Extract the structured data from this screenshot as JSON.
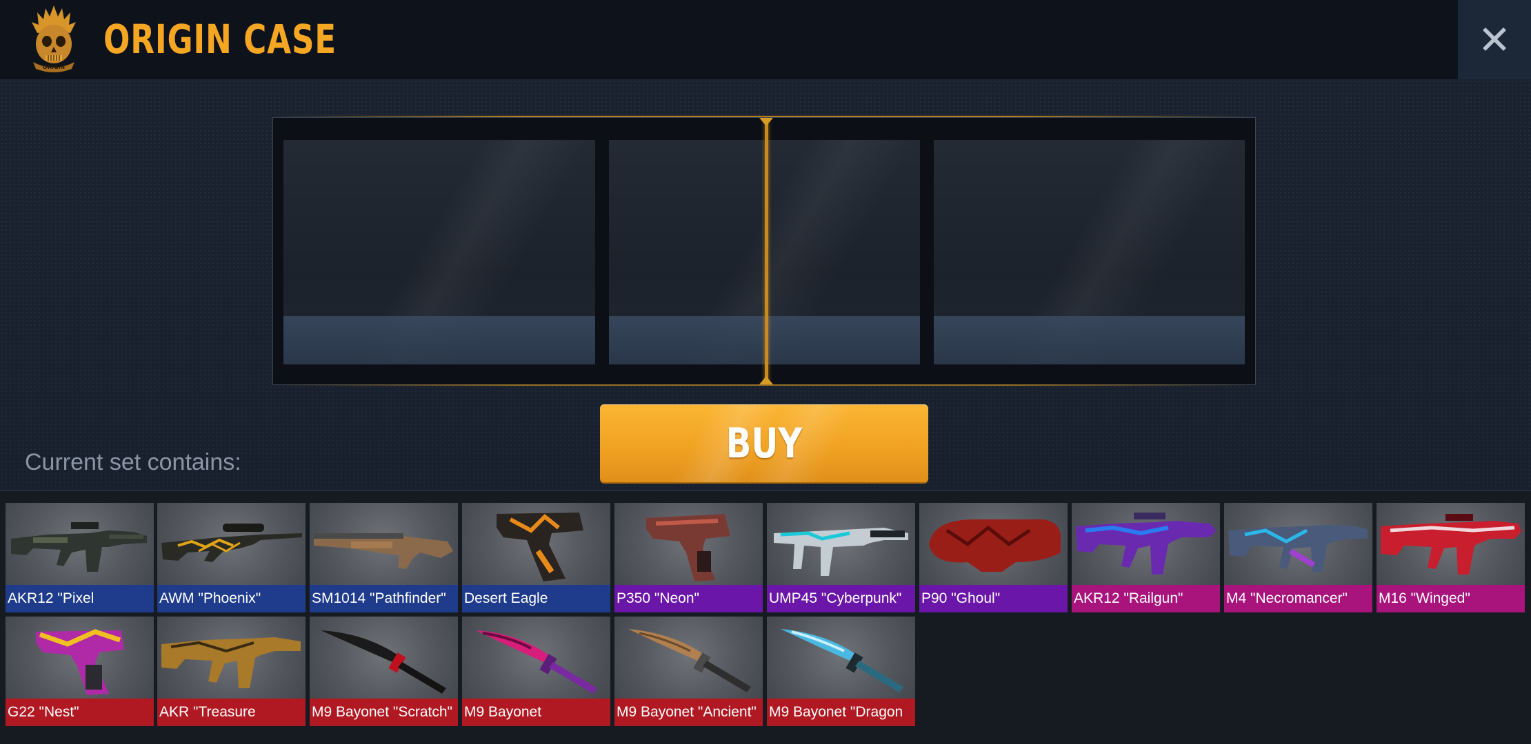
{
  "header": {
    "title": "ORIGIN CASE",
    "logo_text": "ORIGIN",
    "close_glyph": "✕"
  },
  "buy_button": {
    "label": "BUY"
  },
  "set_label": "Current set contains:",
  "colors": {
    "accent": "#f5a623",
    "rarity_blue": "#1f3c8c",
    "rarity_purple": "#6a16a8",
    "rarity_pink": "#a8137c",
    "rarity_red": "#b01822"
  },
  "items": [
    {
      "name": "AKR12 \"Pixel",
      "rarity": "blue",
      "icon": "rifle-icon"
    },
    {
      "name": "AWM \"Phoenix\"",
      "rarity": "blue",
      "icon": "sniper-rifle-icon"
    },
    {
      "name": "SM1014 \"Pathfinder\"",
      "rarity": "blue",
      "icon": "shotgun-icon"
    },
    {
      "name": "Desert Eagle",
      "rarity": "blue",
      "icon": "pistol-icon"
    },
    {
      "name": "P350 \"Neon\"",
      "rarity": "purple",
      "icon": "pistol-icon"
    },
    {
      "name": "UMP45 \"Cyberpunk\"",
      "rarity": "purple",
      "icon": "smg-icon"
    },
    {
      "name": "P90 \"Ghoul\"",
      "rarity": "purple",
      "icon": "smg-icon"
    },
    {
      "name": "AKR12 \"Railgun\"",
      "rarity": "pink",
      "icon": "rifle-icon"
    },
    {
      "name": "M4 \"Necromancer\"",
      "rarity": "pink",
      "icon": "rifle-icon"
    },
    {
      "name": "M16 \"Winged\"",
      "rarity": "pink",
      "icon": "rifle-icon"
    },
    {
      "name": "G22 \"Nest\"",
      "rarity": "red",
      "icon": "pistol-icon"
    },
    {
      "name": "AKR \"Treasure",
      "rarity": "red",
      "icon": "rifle-icon"
    },
    {
      "name": "M9 Bayonet \"Scratch\"",
      "rarity": "red",
      "icon": "knife-icon"
    },
    {
      "name": "M9 Bayonet",
      "rarity": "red",
      "icon": "knife-icon"
    },
    {
      "name": "M9 Bayonet \"Ancient\"",
      "rarity": "red",
      "icon": "knife-icon"
    },
    {
      "name": "M9 Bayonet \"Dragon",
      "rarity": "red",
      "icon": "knife-icon"
    }
  ]
}
